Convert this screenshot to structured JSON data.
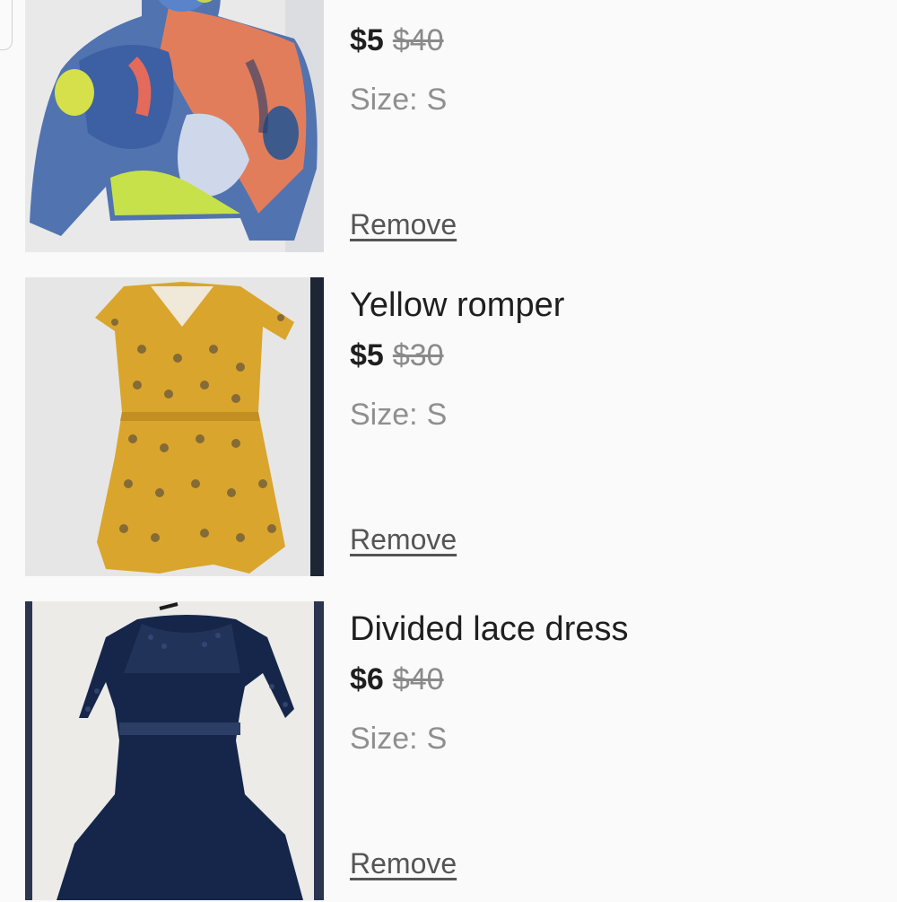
{
  "cart": {
    "items": [
      {
        "title": "",
        "price": "$5",
        "original_price": "$40",
        "size_label": "Size:",
        "size": "S",
        "remove_label": "Remove",
        "image": "tie-dye-hoodie-photo"
      },
      {
        "title": "Yellow romper",
        "price": "$5",
        "original_price": "$30",
        "size_label": "Size:",
        "size": "S",
        "remove_label": "Remove",
        "image": "yellow-romper-photo"
      },
      {
        "title": "Divided lace dress",
        "price": "$6",
        "original_price": "$40",
        "size_label": "Size:",
        "size": "S",
        "remove_label": "Remove",
        "image": "navy-lace-dress-photo"
      }
    ]
  },
  "colors": {
    "background": "#fafafa",
    "text": "#1f1f1f",
    "muted": "#8f8f8f",
    "link": "#555555"
  }
}
